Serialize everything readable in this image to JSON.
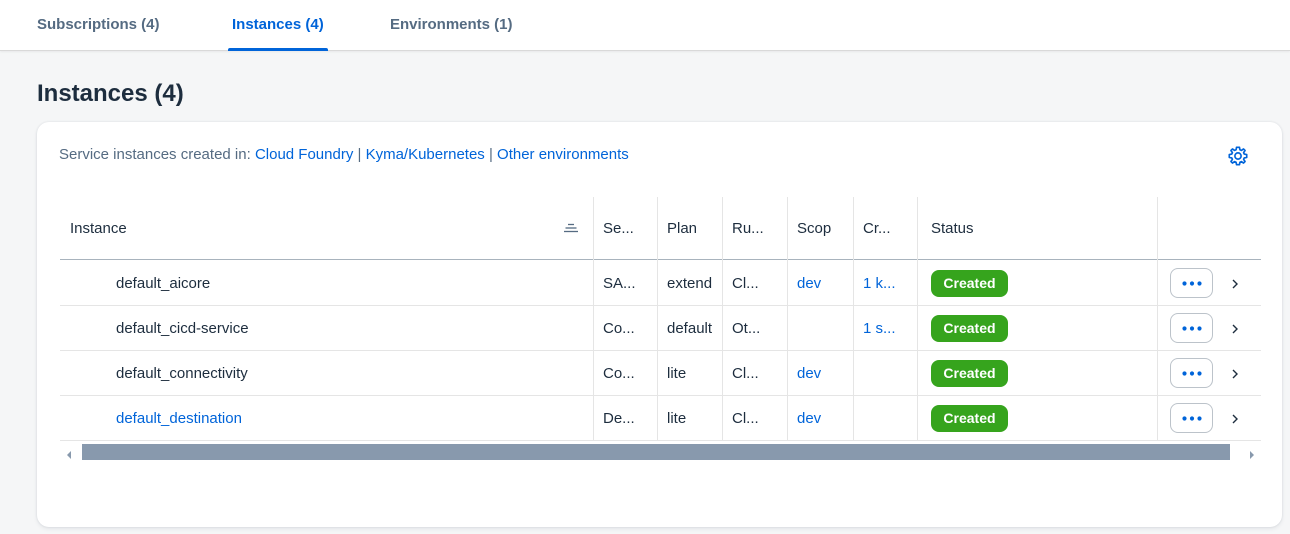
{
  "tabs": [
    {
      "label": "Subscriptions (4)",
      "active": false
    },
    {
      "label": "Instances (4)",
      "active": true
    },
    {
      "label": "Environments (1)",
      "active": false
    }
  ],
  "page_title": "Instances (4)",
  "info": {
    "prefix": "Service instances created in: ",
    "links": [
      "Cloud Foundry",
      "Kyma/Kubernetes",
      "Other environments"
    ],
    "separator": " | "
  },
  "columns": [
    "Instance",
    "Se...",
    "Plan",
    "Ru...",
    "Scop",
    "Cr...",
    "Status"
  ],
  "rows": [
    {
      "instance": "default_aicore",
      "service": "SA...",
      "plan": "extend",
      "runtime": "Cl...",
      "scope": "dev",
      "created": "1 k...",
      "status": "Created"
    },
    {
      "instance": "default_cicd-service",
      "service": "Co...",
      "plan": "default",
      "runtime": "Ot...",
      "scope": "",
      "created": "1 s...",
      "status": "Created"
    },
    {
      "instance": "default_connectivity",
      "service": "Co...",
      "plan": "lite",
      "runtime": "Cl...",
      "scope": "dev",
      "created": "",
      "status": "Created"
    },
    {
      "instance": "default_destination",
      "service": "De...",
      "plan": "lite",
      "runtime": "Cl...",
      "scope": "dev",
      "created": "",
      "status": "Created"
    }
  ],
  "icons": {
    "settings": "gear-icon",
    "sort": "sort-icon",
    "row_actions": "overflow-dots-icon",
    "row_navigate": "chevron-right-icon"
  },
  "colors": {
    "accent": "#0064d9",
    "status_created": "#36a41d",
    "scrollbar_thumb": "#8899ad"
  }
}
